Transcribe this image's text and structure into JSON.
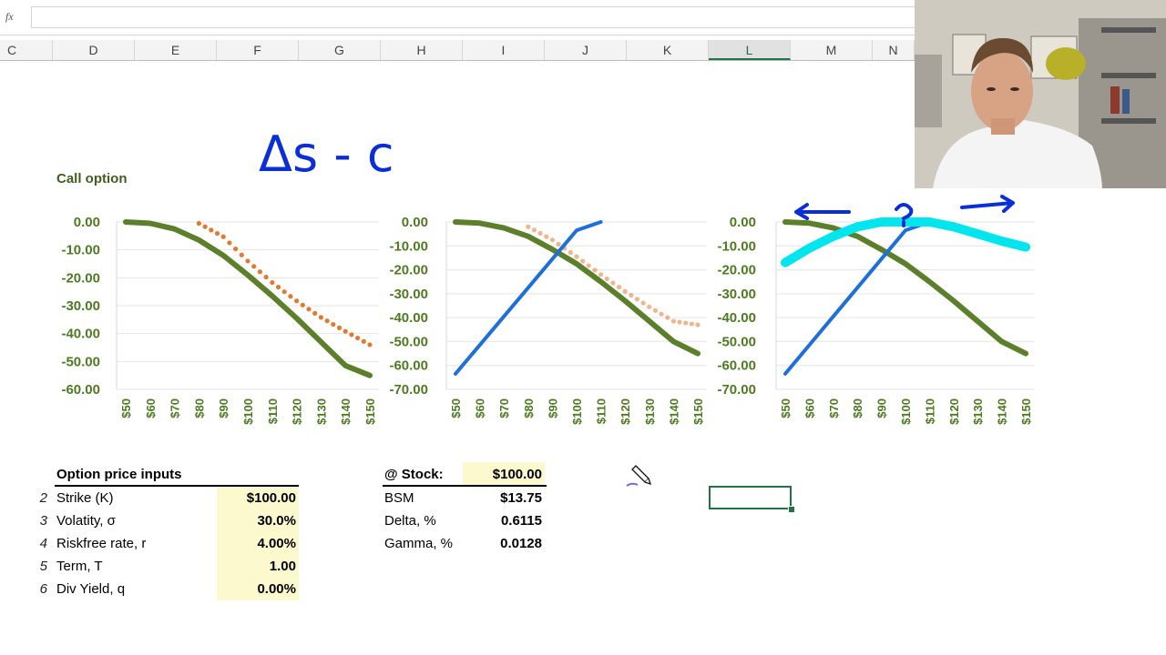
{
  "formula_bar": {
    "fx_label": "fx",
    "value": ""
  },
  "columns": [
    {
      "label": "C",
      "selected": false
    },
    {
      "label": "D",
      "selected": false
    },
    {
      "label": "E",
      "selected": false
    },
    {
      "label": "F",
      "selected": false
    },
    {
      "label": "G",
      "selected": false
    },
    {
      "label": "H",
      "selected": false
    },
    {
      "label": "I",
      "selected": false
    },
    {
      "label": "J",
      "selected": false
    },
    {
      "label": "K",
      "selected": false
    },
    {
      "label": "L",
      "selected": true
    },
    {
      "label": "M",
      "selected": false
    },
    {
      "label": "N",
      "selected": false
    }
  ],
  "sheet_title": "Call option",
  "handwritten_note": "Δs - c",
  "inputs": {
    "header": "Option price inputs",
    "rows": [
      {
        "num": "2",
        "label": "Strike (K)",
        "value": "$100.00"
      },
      {
        "num": "3",
        "label": "Volatity, σ",
        "value": "30.0%"
      },
      {
        "num": "4",
        "label": "Riskfree rate, r",
        "value": "4.00%"
      },
      {
        "num": "5",
        "label": "Term, T",
        "value": "1.00"
      },
      {
        "num": "6",
        "label": "Div Yield, q",
        "value": "0.00%"
      }
    ]
  },
  "outputs": {
    "header_label": "@ Stock:",
    "header_value": "$100.00",
    "rows": [
      {
        "label": "BSM",
        "value": "$13.75"
      },
      {
        "label": "Delta, %",
        "value": "0.6115"
      },
      {
        "label": "Gamma, %",
        "value": "0.0128"
      }
    ]
  },
  "colors": {
    "green_series": "#5b7f2b",
    "orange_series": "#e07a32",
    "blue_series": "#1f6fd8",
    "cyan_series": "#00e5ee",
    "ink_blue": "#0a2fd6",
    "accent": "#217346",
    "tick_green": "#4e7a22"
  },
  "chart_data": [
    {
      "type": "line",
      "x": [
        "$50",
        "$60",
        "$70",
        "$80",
        "$90",
        "$100",
        "$110",
        "$120",
        "$130",
        "$140",
        "$150"
      ],
      "yticks": [
        "0.00",
        "-10.00",
        "-20.00",
        "-30.00",
        "-40.00",
        "-50.00",
        "-60.00"
      ],
      "ylim": [
        -60,
        0
      ],
      "series": [
        {
          "style": "solid-green",
          "values": [
            0,
            -0.5,
            -2.5,
            -6.5,
            -12,
            -19,
            -26.5,
            -34.5,
            -43,
            -51.5,
            -55
          ]
        },
        {
          "style": "dotted-orange",
          "values": [
            null,
            null,
            null,
            -0.5,
            -5.3,
            -14,
            -21.7,
            -28.3,
            -34.2,
            -39.2,
            -44
          ]
        }
      ]
    },
    {
      "type": "line",
      "x": [
        "$50",
        "$60",
        "$70",
        "$80",
        "$90",
        "$100",
        "$110",
        "$120",
        "$130",
        "$140",
        "$150"
      ],
      "yticks": [
        "0.00",
        "-10.00",
        "-20.00",
        "-30.00",
        "-40.00",
        "-50.00",
        "-60.00",
        "-70.00"
      ],
      "ylim": [
        -70,
        0
      ],
      "series": [
        {
          "style": "solid-green",
          "values": [
            0,
            -0.5,
            -2.5,
            -6,
            -11.5,
            -17.5,
            -25,
            -33,
            -41.5,
            -50,
            -55
          ]
        },
        {
          "style": "dotted-orange",
          "values": [
            null,
            null,
            null,
            -2,
            -7.5,
            -14.5,
            -22,
            -29,
            -35.5,
            -41.5,
            -43
          ]
        },
        {
          "style": "solid-blue",
          "values": [
            -63.5,
            -51.5,
            -39.5,
            -27.5,
            -15.5,
            -3.5,
            0,
            null,
            null,
            null,
            null
          ]
        }
      ]
    },
    {
      "type": "line",
      "x": [
        "$50",
        "$60",
        "$70",
        "$80",
        "$90",
        "$100",
        "$110",
        "$120",
        "$130",
        "$140",
        "$150"
      ],
      "yticks": [
        "0.00",
        "-10.00",
        "-20.00",
        "-30.00",
        "-40.00",
        "-50.00",
        "-60.00",
        "-70.00"
      ],
      "ylim": [
        -70,
        0
      ],
      "series": [
        {
          "style": "solid-green",
          "values": [
            0,
            -0.5,
            -2.5,
            -6,
            -11.5,
            -17.5,
            -25,
            -33,
            -41.5,
            -50,
            -55
          ]
        },
        {
          "style": "solid-blue",
          "values": [
            -63.5,
            -51.5,
            -39.5,
            -27.5,
            -15.5,
            -3.5,
            0,
            null,
            null,
            null,
            null
          ]
        },
        {
          "style": "cyan-marker",
          "values": [
            -17,
            -11,
            -6,
            -2,
            0,
            0,
            0,
            -2,
            -5,
            -8,
            -10.5
          ]
        }
      ]
    }
  ]
}
